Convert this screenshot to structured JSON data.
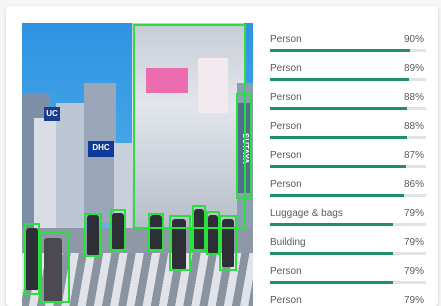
{
  "results": [
    {
      "label": "Person",
      "score": "90%",
      "fraction": 0.9
    },
    {
      "label": "Person",
      "score": "89%",
      "fraction": 0.89
    },
    {
      "label": "Person",
      "score": "88%",
      "fraction": 0.88
    },
    {
      "label": "Person",
      "score": "88%",
      "fraction": 0.88
    },
    {
      "label": "Person",
      "score": "87%",
      "fraction": 0.87
    },
    {
      "label": "Person",
      "score": "86%",
      "fraction": 0.86
    },
    {
      "label": "Luggage & bags",
      "score": "79%",
      "fraction": 0.79
    },
    {
      "label": "Building",
      "score": "79%",
      "fraction": 0.79
    },
    {
      "label": "Person",
      "score": "79%",
      "fraction": 0.79
    },
    {
      "label": "Person",
      "score": "79%",
      "fraction": 0.79
    }
  ],
  "photo_signs": {
    "dhc": "DHC",
    "uc": "UC",
    "tsutaya": "SUTAYA"
  },
  "colors": {
    "detection_box": "#2be03e",
    "score_bar": "#1f8f6b",
    "score_track": "#e3e3e3"
  }
}
